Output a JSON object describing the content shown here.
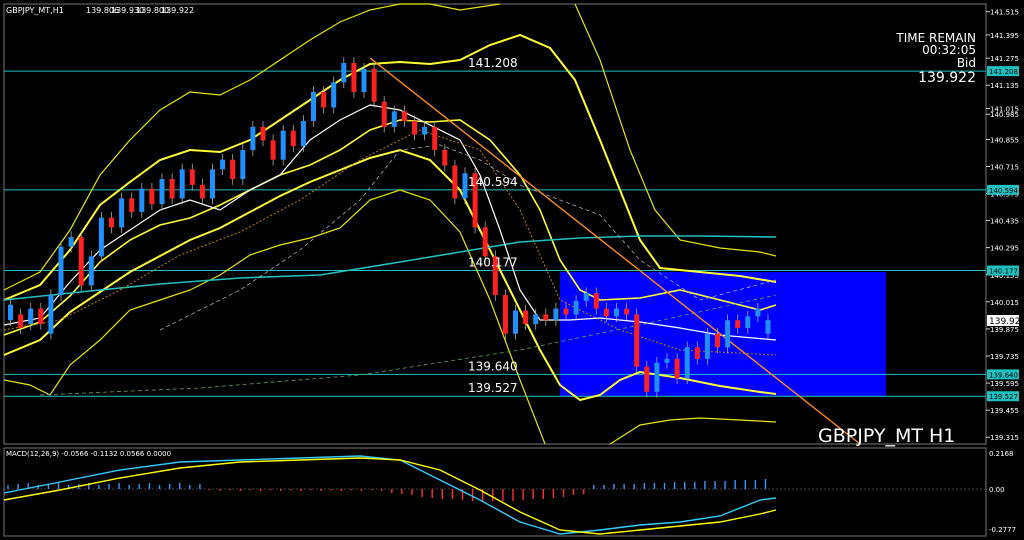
{
  "header": {
    "symbol_info": "GBPJPY_MT,H1",
    "ohlc": [
      "139.806",
      "139.930",
      "139.800",
      "139.922"
    ]
  },
  "time_panel": {
    "label": "TIME REMAIN",
    "countdown": "00:32:05",
    "bid_label": "Bid",
    "bid": "139.922"
  },
  "watermark": "GBPJPY_MT H1",
  "macd": {
    "label": "MACD(12,26,9) -0.0566 -0.1132 0.0566 0.0000",
    "axis_labels": [
      "0.2168",
      "0.00",
      "-0.2777"
    ]
  },
  "price_axis": {
    "min": 139.28,
    "max": 141.555,
    "ticks": [
      "141.515",
      "141.395",
      "141.275",
      "141.135",
      "141.015",
      "140.985",
      "140.855",
      "140.715",
      "140.575",
      "140.435",
      "140.295",
      "140.155",
      "140.015",
      "139.875",
      "139.735",
      "139.595",
      "139.455",
      "139.315"
    ]
  },
  "levels": [
    {
      "label": "141.208",
      "tag": "141.208",
      "value": 141.208
    },
    {
      "label": "140.594",
      "tag": "140.594",
      "value": 140.594
    },
    {
      "label": "140.177",
      "tag": "140.177",
      "value": 140.177
    },
    {
      "label": "139.640",
      "tag": "139.640",
      "value": 139.64
    },
    {
      "label": "139.527",
      "tag": "139.527",
      "value": 139.527
    }
  ],
  "current_price_tag": "139.922",
  "zone": {
    "top": 140.177,
    "bottom": 139.527
  },
  "colors": {
    "background": "#000000",
    "bull": "#1e90ff",
    "bear": "#ff2020",
    "bands": "#ffff33",
    "ma_long": "#20c0c0",
    "level": "#20c0c0",
    "zone": "#0000ff",
    "trendline": "#ff8c1a",
    "macd_line": "#33ccff",
    "signal_line": "#ffff00"
  },
  "chart_data": {
    "type": "candlestick",
    "series": [
      {
        "values": [
          [
            139.9,
            140.0,
            139.85,
            139.95
          ],
          [
            139.95,
            140.02,
            139.9,
            139.92
          ],
          [
            139.92,
            140.05,
            139.9,
            140.0
          ]
        ]
      }
    ]
  }
}
